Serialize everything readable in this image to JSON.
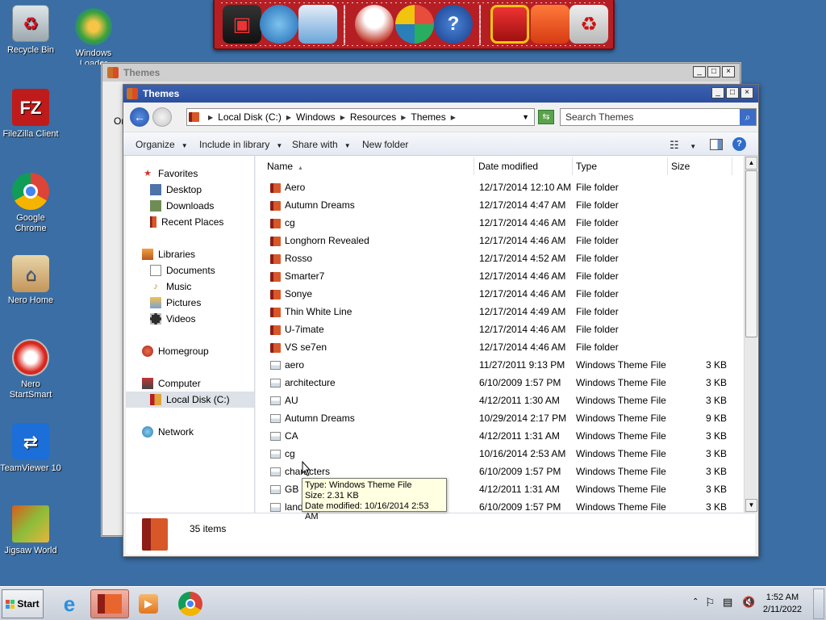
{
  "desktop": {
    "icons": [
      {
        "label": "Recycle Bin",
        "icon": "recycle-bin-icon"
      },
      {
        "label": "Windows Loader",
        "icon": "windows-loader-icon"
      },
      {
        "label": "FileZilla Client",
        "icon": "filezilla-icon"
      },
      {
        "label": "Google Chrome",
        "icon": "chrome-icon"
      },
      {
        "label": "Nero Home",
        "icon": "nero-home-icon"
      },
      {
        "label": "Nero StartSmart",
        "icon": "nero-startsmart-icon"
      },
      {
        "label": "TeamViewer 10",
        "icon": "teamviewer-icon"
      },
      {
        "label": "Jigsaw World",
        "icon": "jigsaw-icon"
      }
    ]
  },
  "dock": {
    "items": [
      "computer-icon",
      "network-icon",
      "control-panel-icon",
      "snowman-icon",
      "windows-update-icon",
      "help-icon",
      "gift-icon",
      "folder-icon",
      "recycle-bin-icon"
    ]
  },
  "back_window": {
    "title": "Themes",
    "partial_label": "Or"
  },
  "window": {
    "title": "Themes",
    "controls": {
      "minimize": "_",
      "maximize": "□",
      "close": "×"
    },
    "breadcrumb": [
      "Local Disk (C:)",
      "Windows",
      "Resources",
      "Themes"
    ],
    "search_placeholder": "Search Themes",
    "toolbar": {
      "organize": "Organize",
      "include": "Include in library",
      "share": "Share with",
      "new_folder": "New folder"
    },
    "nav": {
      "favorites": "Favorites",
      "desktop": "Desktop",
      "downloads": "Downloads",
      "recent": "Recent Places",
      "libraries": "Libraries",
      "documents": "Documents",
      "music": "Music",
      "pictures": "Pictures",
      "videos": "Videos",
      "homegroup": "Homegroup",
      "computer": "Computer",
      "local_disk": "Local Disk (C:)",
      "network": "Network"
    },
    "columns": {
      "name": "Name",
      "date": "Date modified",
      "type": "Type",
      "size": "Size"
    },
    "files": [
      {
        "name": "Aero",
        "date": "12/17/2014 12:10 AM",
        "type": "File folder",
        "size": "",
        "kind": "folder"
      },
      {
        "name": "Autumn Dreams",
        "date": "12/17/2014 4:47 AM",
        "type": "File folder",
        "size": "",
        "kind": "folder"
      },
      {
        "name": "cg",
        "date": "12/17/2014 4:46 AM",
        "type": "File folder",
        "size": "",
        "kind": "folder"
      },
      {
        "name": "Longhorn Revealed",
        "date": "12/17/2014 4:46 AM",
        "type": "File folder",
        "size": "",
        "kind": "folder"
      },
      {
        "name": "Rosso",
        "date": "12/17/2014 4:52 AM",
        "type": "File folder",
        "size": "",
        "kind": "folder"
      },
      {
        "name": "Smarter7",
        "date": "12/17/2014 4:46 AM",
        "type": "File folder",
        "size": "",
        "kind": "folder"
      },
      {
        "name": "Sonye",
        "date": "12/17/2014 4:46 AM",
        "type": "File folder",
        "size": "",
        "kind": "folder"
      },
      {
        "name": "Thin White Line",
        "date": "12/17/2014 4:49 AM",
        "type": "File folder",
        "size": "",
        "kind": "folder"
      },
      {
        "name": "U-7imate",
        "date": "12/17/2014 4:46 AM",
        "type": "File folder",
        "size": "",
        "kind": "folder"
      },
      {
        "name": "VS se7en",
        "date": "12/17/2014 4:46 AM",
        "type": "File folder",
        "size": "",
        "kind": "folder"
      },
      {
        "name": "aero",
        "date": "11/27/2011 9:13 PM",
        "type": "Windows Theme File",
        "size": "3 KB",
        "kind": "theme"
      },
      {
        "name": "architecture",
        "date": "6/10/2009 1:57 PM",
        "type": "Windows Theme File",
        "size": "3 KB",
        "kind": "theme"
      },
      {
        "name": "AU",
        "date": "4/12/2011 1:30 AM",
        "type": "Windows Theme File",
        "size": "3 KB",
        "kind": "theme"
      },
      {
        "name": "Autumn Dreams",
        "date": "10/29/2014 2:17 PM",
        "type": "Windows Theme File",
        "size": "9 KB",
        "kind": "theme"
      },
      {
        "name": "CA",
        "date": "4/12/2011 1:31 AM",
        "type": "Windows Theme File",
        "size": "3 KB",
        "kind": "theme"
      },
      {
        "name": "cg",
        "date": "10/16/2014 2:53 AM",
        "type": "Windows Theme File",
        "size": "3 KB",
        "kind": "theme"
      },
      {
        "name": "characters",
        "date": "6/10/2009 1:57 PM",
        "type": "Windows Theme File",
        "size": "3 KB",
        "kind": "theme"
      },
      {
        "name": "GB",
        "date": "4/12/2011 1:31 AM",
        "type": "Windows Theme File",
        "size": "3 KB",
        "kind": "theme"
      },
      {
        "name": "landscapes",
        "date": "6/10/2009 1:57 PM",
        "type": "Windows Theme File",
        "size": "3 KB",
        "kind": "theme"
      }
    ],
    "status": {
      "count": "35 items"
    },
    "tooltip": {
      "type": "Type: Windows Theme File",
      "size": "Size: 2.31 KB",
      "date": "Date modified: 10/16/2014 2:53 AM"
    }
  },
  "taskbar": {
    "start_label": "Start",
    "apps": [
      "internet-explorer-icon",
      "explorer-icon",
      "media-player-icon",
      "chrome-icon"
    ],
    "clock": {
      "time": "1:52 AM",
      "date": "2/11/2022"
    }
  }
}
